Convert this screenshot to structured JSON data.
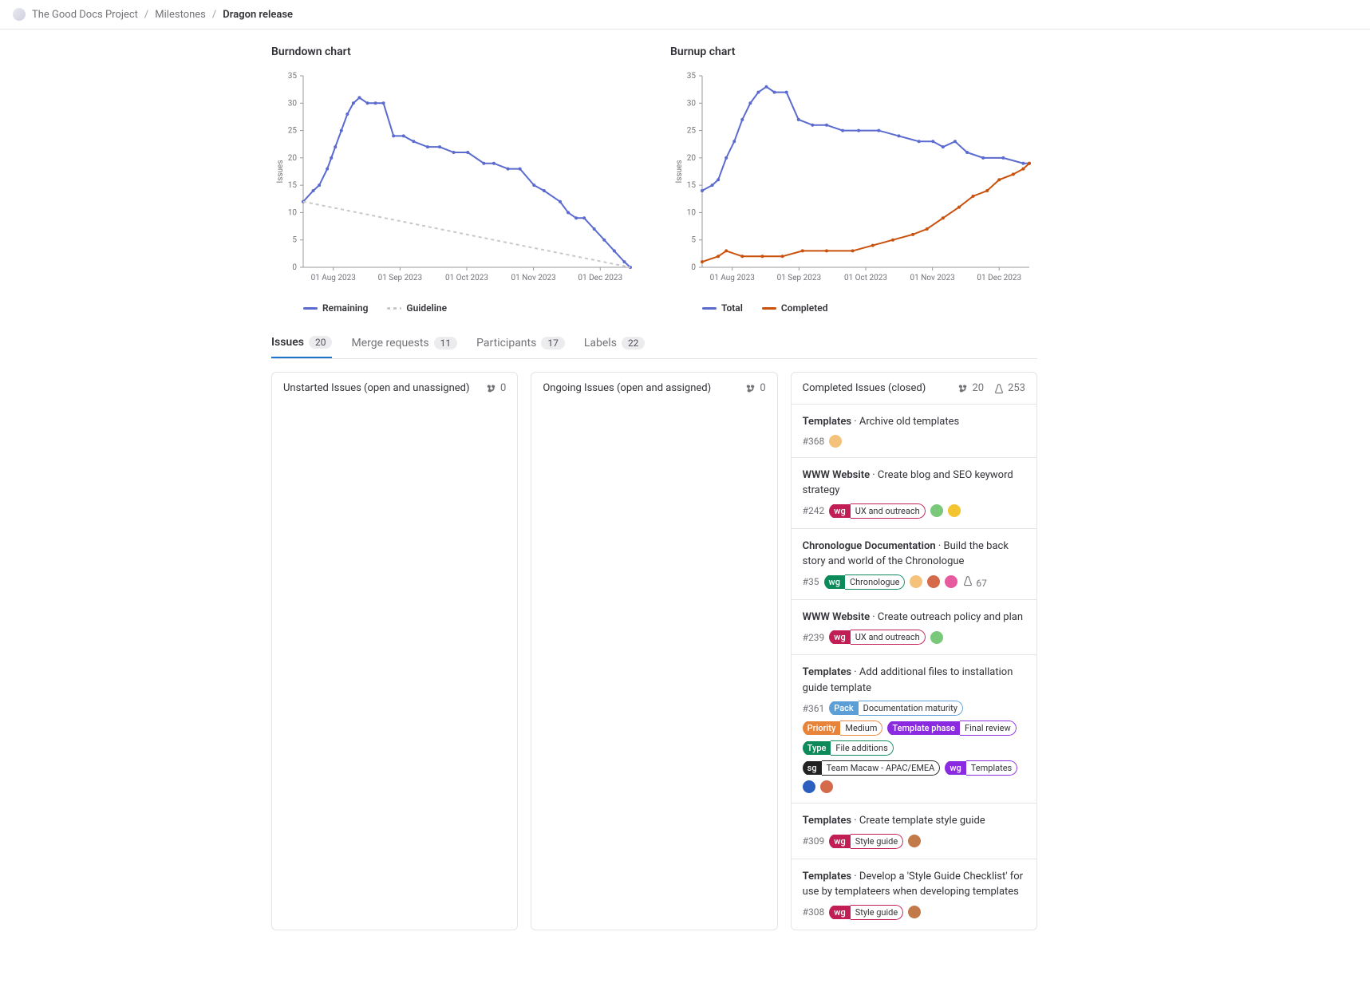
{
  "breadcrumb": {
    "project": "The Good Docs Project",
    "section": "Milestones",
    "current": "Dragon release"
  },
  "tabs": [
    {
      "label": "Issues",
      "count": "20",
      "active": true
    },
    {
      "label": "Merge requests",
      "count": "11",
      "active": false
    },
    {
      "label": "Participants",
      "count": "17",
      "active": false
    },
    {
      "label": "Labels",
      "count": "22",
      "active": false
    }
  ],
  "columns": {
    "unstarted": {
      "title": "Unstarted Issues (open and unassigned)",
      "merge_count": "0"
    },
    "ongoing": {
      "title": "Ongoing Issues (open and assigned)",
      "merge_count": "0"
    },
    "completed": {
      "title": "Completed Issues (closed)",
      "merge_count": "20",
      "weight": "253"
    }
  },
  "issues_completed": [
    {
      "project": "Templates",
      "title": "Archive old templates",
      "ref": "#368",
      "labels": [],
      "avatars": [
        {
          "bg": "#f4c27a"
        }
      ]
    },
    {
      "project": "WWW Website",
      "title": "Create blog and SEO keyword strategy",
      "ref": "#242",
      "labels": [
        {
          "scope": "wg",
          "val": "UX and outreach",
          "color": "#c21e56"
        }
      ],
      "avatars": [
        {
          "bg": "#7ac97a"
        },
        {
          "bg": "#f4c430"
        }
      ]
    },
    {
      "project": "Chronologue Documentation",
      "title": "Build the back story and world of the Chronologue",
      "ref": "#35",
      "labels": [
        {
          "scope": "wg",
          "val": "Chronologue",
          "color": "#0d8a5a"
        }
      ],
      "avatars": [
        {
          "bg": "#f4c27a"
        },
        {
          "bg": "#d46a4a"
        },
        {
          "bg": "#e85aa0"
        }
      ],
      "weight": "67"
    },
    {
      "project": "WWW Website",
      "title": "Create outreach policy and plan",
      "ref": "#239",
      "labels": [
        {
          "scope": "wg",
          "val": "UX and outreach",
          "color": "#c21e56"
        }
      ],
      "avatars": [
        {
          "bg": "#7ac97a"
        }
      ]
    },
    {
      "project": "Templates",
      "title": "Add additional files to installation guide template",
      "ref": "#361",
      "labels": [
        {
          "scope": "Pack",
          "val": "Documentation maturity",
          "color": "#5c9fd6"
        },
        {
          "scope": "Priority",
          "val": "Medium",
          "color": "#e8833a"
        },
        {
          "scope": "Template phase",
          "val": "Final review",
          "color": "#8a2be2"
        },
        {
          "scope": "Type",
          "val": "File additions",
          "color": "#0d8a5a"
        },
        {
          "scope": "sg",
          "val": "Team Macaw - APAC/EMEA",
          "color": "#222"
        },
        {
          "scope": "wg",
          "val": "Templates",
          "color": "#8a2be2"
        }
      ],
      "avatars": [
        {
          "bg": "#2c5fbf"
        },
        {
          "bg": "#d46a4a"
        }
      ]
    },
    {
      "project": "Templates",
      "title": "Create template style guide",
      "ref": "#309",
      "labels": [
        {
          "scope": "wg",
          "val": "Style guide",
          "color": "#c21e56"
        }
      ],
      "avatars": [
        {
          "bg": "#c27a4a"
        }
      ]
    },
    {
      "project": "Templates",
      "title": "Develop a 'Style Guide Checklist' for use by templateers when developing templates",
      "ref": "#308",
      "labels": [
        {
          "scope": "wg",
          "val": "Style guide",
          "color": "#c21e56"
        }
      ],
      "avatars": [
        {
          "bg": "#c27a4a"
        }
      ]
    }
  ],
  "chart_data": [
    {
      "type": "line",
      "title": "Burndown chart",
      "ylabel": "Issues",
      "ylim": [
        0,
        35
      ],
      "y_ticks": [
        0,
        5,
        10,
        15,
        20,
        25,
        30,
        35
      ],
      "categories": [
        "01 Aug 2023",
        "01 Sep 2023",
        "01 Oct 2023",
        "01 Nov 2023",
        "01 Dec 2023"
      ],
      "series": [
        {
          "name": "Remaining",
          "color": "#5a6acf",
          "_comment": "x is day offset from mid-July-2023; y is issue count",
          "points": [
            [
              0,
              12
            ],
            [
              5,
              14
            ],
            [
              8,
              15
            ],
            [
              12,
              18
            ],
            [
              14,
              20
            ],
            [
              16,
              22
            ],
            [
              19,
              25
            ],
            [
              22,
              28
            ],
            [
              25,
              30
            ],
            [
              28,
              31
            ],
            [
              32,
              30
            ],
            [
              36,
              30
            ],
            [
              40,
              30
            ],
            [
              45,
              24
            ],
            [
              50,
              24
            ],
            [
              55,
              23
            ],
            [
              62,
              22
            ],
            [
              68,
              22
            ],
            [
              75,
              21
            ],
            [
              82,
              21
            ],
            [
              90,
              19
            ],
            [
              95,
              19
            ],
            [
              102,
              18
            ],
            [
              108,
              18
            ],
            [
              115,
              15
            ],
            [
              120,
              14
            ],
            [
              128,
              12
            ],
            [
              132,
              10
            ],
            [
              136,
              9
            ],
            [
              140,
              9
            ],
            [
              145,
              7
            ],
            [
              150,
              5
            ],
            [
              155,
              3
            ],
            [
              160,
              1
            ],
            [
              163,
              0
            ]
          ]
        },
        {
          "name": "Guideline",
          "color": "#c8c8c8",
          "dashed": true,
          "points": [
            [
              0,
              12
            ],
            [
              163,
              0
            ]
          ]
        }
      ]
    },
    {
      "type": "line",
      "title": "Burnup chart",
      "ylabel": "Issues",
      "ylim": [
        0,
        35
      ],
      "y_ticks": [
        0,
        5,
        10,
        15,
        20,
        25,
        30,
        35
      ],
      "categories": [
        "01 Aug 2023",
        "01 Sep 2023",
        "01 Oct 2023",
        "01 Nov 2023",
        "01 Dec 2023"
      ],
      "series": [
        {
          "name": "Total",
          "color": "#5a6acf",
          "points": [
            [
              0,
              14
            ],
            [
              5,
              15
            ],
            [
              8,
              16
            ],
            [
              12,
              20
            ],
            [
              16,
              23
            ],
            [
              20,
              27
            ],
            [
              24,
              30
            ],
            [
              28,
              32
            ],
            [
              32,
              33
            ],
            [
              36,
              32
            ],
            [
              42,
              32
            ],
            [
              48,
              27
            ],
            [
              55,
              26
            ],
            [
              62,
              26
            ],
            [
              70,
              25
            ],
            [
              78,
              25
            ],
            [
              88,
              25
            ],
            [
              98,
              24
            ],
            [
              108,
              23
            ],
            [
              115,
              23
            ],
            [
              120,
              22
            ],
            [
              126,
              23
            ],
            [
              132,
              21
            ],
            [
              140,
              20
            ],
            [
              150,
              20
            ],
            [
              160,
              19
            ],
            [
              163,
              19
            ]
          ]
        },
        {
          "name": "Completed",
          "color": "#c9510c",
          "points": [
            [
              0,
              1
            ],
            [
              8,
              2
            ],
            [
              12,
              3
            ],
            [
              20,
              2
            ],
            [
              30,
              2
            ],
            [
              40,
              2
            ],
            [
              50,
              3
            ],
            [
              62,
              3
            ],
            [
              75,
              3
            ],
            [
              85,
              4
            ],
            [
              95,
              5
            ],
            [
              105,
              6
            ],
            [
              112,
              7
            ],
            [
              120,
              9
            ],
            [
              128,
              11
            ],
            [
              135,
              13
            ],
            [
              142,
              14
            ],
            [
              148,
              16
            ],
            [
              155,
              17
            ],
            [
              160,
              18
            ],
            [
              163,
              19
            ]
          ]
        }
      ]
    }
  ]
}
